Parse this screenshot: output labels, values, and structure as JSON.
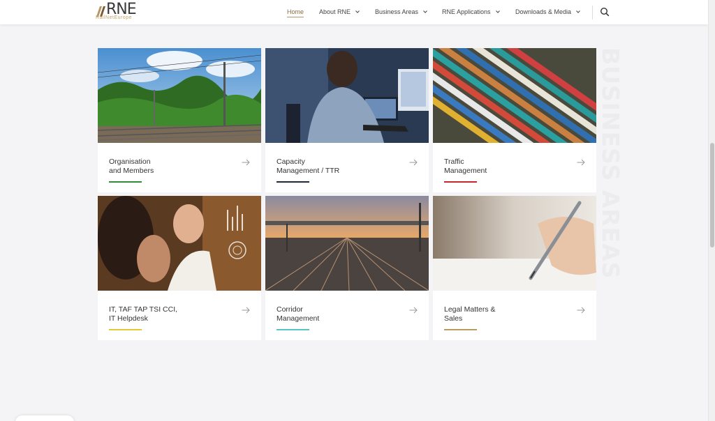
{
  "header": {
    "logo_text": "RNE",
    "logo_sub": "RailNetEurope",
    "nav": [
      {
        "label": "Home",
        "active": true,
        "has_dropdown": false
      },
      {
        "label": "About RNE",
        "active": false,
        "has_dropdown": true
      },
      {
        "label": "Business Areas",
        "active": false,
        "has_dropdown": true
      },
      {
        "label": "RNE Applications",
        "active": false,
        "has_dropdown": true
      },
      {
        "label": "Downloads & Media",
        "active": false,
        "has_dropdown": true
      }
    ],
    "search_icon": "search-icon"
  },
  "section_title": "BUSINESS AREAS",
  "cards": [
    {
      "line1": "Organisation",
      "line2": "and Members",
      "accent": "#2e8b3a",
      "image": "rail-track-landscape"
    },
    {
      "line1": "Capacity",
      "line2": "Management / TTR",
      "accent": "#1e2a3a",
      "image": "operator-at-computer"
    },
    {
      "line1": "Traffic",
      "line2": "Management",
      "accent": "#c0282d",
      "image": "freight-wagons-aerial"
    },
    {
      "line1": "IT, TAF TAP TSI CCI,",
      "line2": "IT Helpdesk",
      "accent": "#e5c83a",
      "image": "people-with-digital-screen"
    },
    {
      "line1": "Corridor",
      "line2": "Management",
      "accent": "#5bc4c0",
      "image": "rail-yard-sunset"
    },
    {
      "line1": "Legal Matters &",
      "line2": "Sales",
      "accent": "#b99a5f",
      "image": "hand-writing-pen"
    }
  ],
  "colors": {
    "brand_gold": "#b79566",
    "background": "#f4f4f6"
  }
}
